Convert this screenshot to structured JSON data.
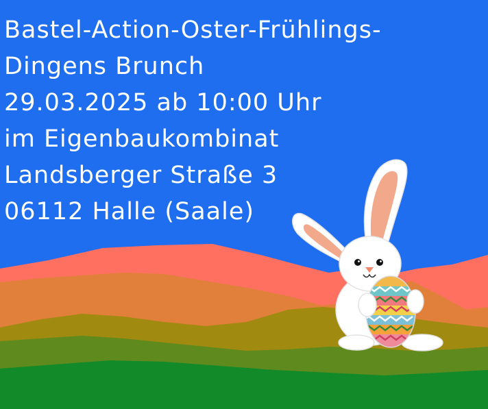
{
  "event": {
    "title_line_1": "Bastel-Action-Oster-Frühlings-",
    "title_line_2": "Dingens Brunch",
    "date_line": "29.03.2025 ab 10:00 Uhr",
    "venue_line": "im Eigenbaukombinat",
    "street_line": "Landsberger Straße 3",
    "city_line": "06112 Halle (Saale)"
  },
  "colors": {
    "sky": "#1f6ef0",
    "text": "#ffffff",
    "hill_salmon": "#ff7060",
    "hill_orange": "#e0803a",
    "hill_olive": "#a08a10",
    "hill_grass": "#5e8a1e",
    "meadow": "#128a2a"
  },
  "illustration": {
    "bunny_icon": "easter-bunny-icon",
    "egg_icon": "easter-egg-icon"
  }
}
